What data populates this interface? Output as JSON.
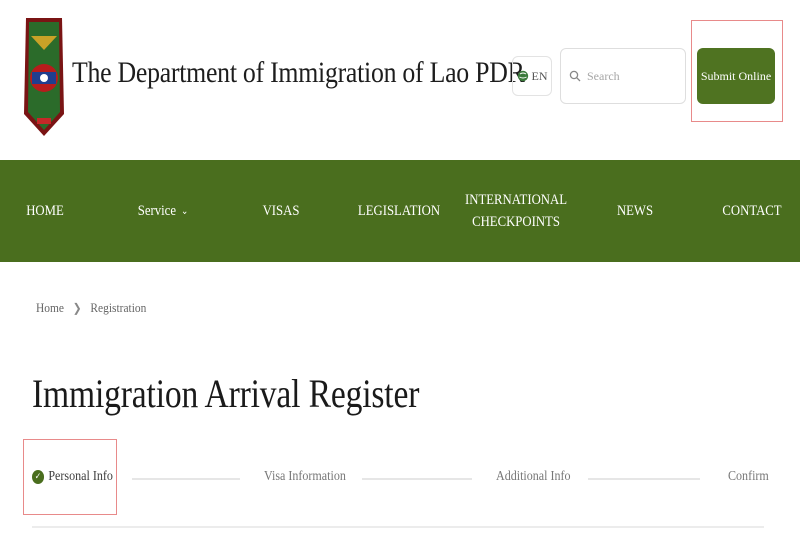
{
  "header": {
    "site_title": "The Department of Immigration of Lao PDR",
    "language": "EN",
    "search_placeholder": "Search",
    "submit_label": "Submit Online"
  },
  "nav": {
    "items": [
      {
        "label": "HOME"
      },
      {
        "label": "Service"
      },
      {
        "label": "VISAS"
      },
      {
        "label": "LEGISLATION"
      },
      {
        "label_line1": "INTERNATIONAL",
        "label_line2": "CHECKPOINTS"
      },
      {
        "label": "NEWS"
      },
      {
        "label": "CONTACT"
      }
    ]
  },
  "breadcrumb": {
    "home": "Home",
    "current": "Registration"
  },
  "page": {
    "title": "Immigration Arrival Register"
  },
  "stepper": {
    "steps": [
      {
        "label": "Personal Info",
        "status": "complete"
      },
      {
        "label": "Visa Information",
        "status": "pending"
      },
      {
        "label": "Additional Info",
        "status": "pending"
      },
      {
        "label": "Confirm",
        "status": "pending"
      }
    ]
  },
  "colors": {
    "brand_green": "#4a6e1e",
    "button_green": "#4f7321",
    "highlight_red": "#e88a8a"
  },
  "icons": {
    "emblem": "lao-emblem-icon",
    "language": "globe-icon",
    "search": "search-icon",
    "service_dropdown": "chevron-down-icon",
    "breadcrumb_sep": "chevron-right-icon",
    "step_complete": "check-circle-icon"
  }
}
